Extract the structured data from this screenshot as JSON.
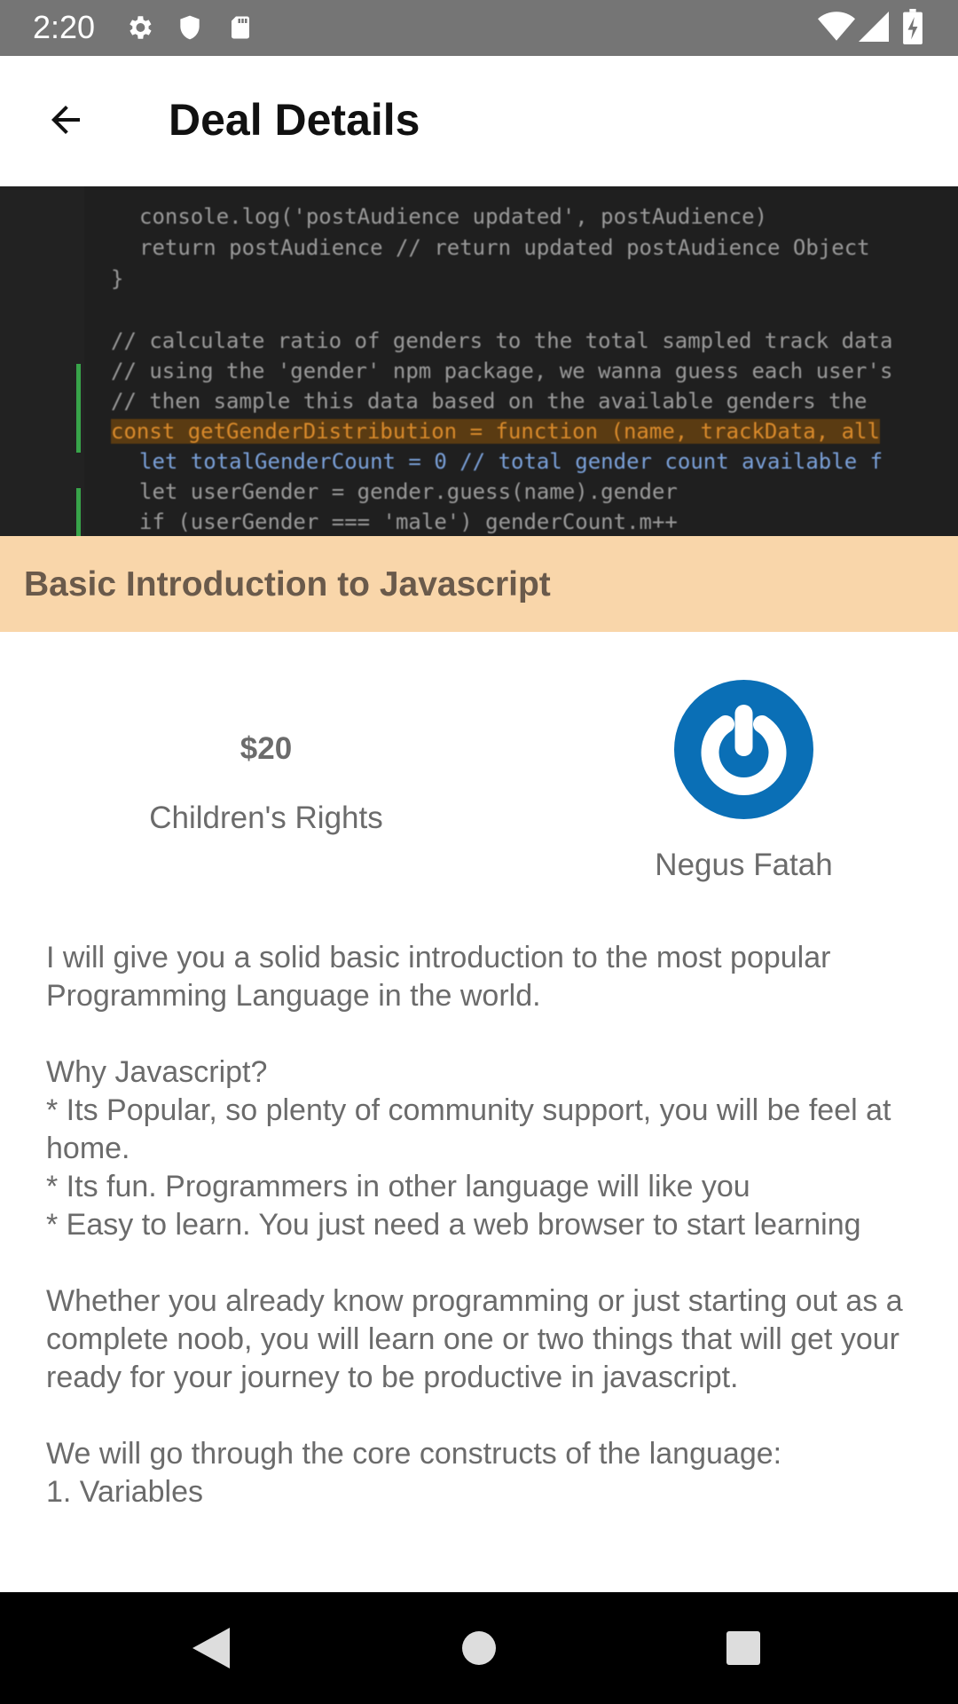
{
  "status_bar": {
    "time": "2:20",
    "icons_left": [
      "gear-icon",
      "shield-icon",
      "sd-card-icon"
    ],
    "icons_right": [
      "wifi-icon",
      "signal-icon",
      "battery-charging-icon"
    ]
  },
  "app_bar": {
    "back_icon": "arrow-back-icon",
    "title": "Deal Details"
  },
  "hero": {
    "code_lines": [
      "console.log('postAudience updated', postAudience)",
      "return postAudience // return updated postAudience Object",
      "}",
      "",
      "// calculate ratio of genders to the total sampled track data",
      "// using the 'gender' npm package, we wanna guess each user's",
      "// then sample this data based on the available genders the",
      "const getGenderDistribution = function (name, trackData, all",
      "let totalGenderCount = 0 // total gender count available f",
      "let userGender = gender.guess(name).gender",
      "if (userGender === 'male') genderCount.m++"
    ]
  },
  "deal": {
    "title": "Basic Introduction to Javascript",
    "price": "$20",
    "cause": "Children's Rights",
    "owner_name": "Negus Fatah",
    "description_paragraphs": [
      "I will give you a solid basic introduction to the most popular Programming Language in the world.",
      "Why Javascript?\n* Its Popular, so plenty of community support, you will be feel at home.\n* Its fun. Programmers in other language will like you\n* Easy to learn. You just need a web browser to start learning",
      "Whether you already know programming or just starting out as a complete noob, you will learn one or two things that will get your ready for your journey to be productive in javascript.",
      "We will go through the core constructs of the language:\n1. Variables"
    ]
  },
  "nav_bar": {
    "back": "triangle-back-icon",
    "home": "circle-home-icon",
    "recents": "square-recents-icon"
  },
  "colors": {
    "status_bar": "#757575",
    "title_band": "#f9d6aa",
    "avatar": "#0a6fb6",
    "text_gray": "#6b6b6b"
  }
}
